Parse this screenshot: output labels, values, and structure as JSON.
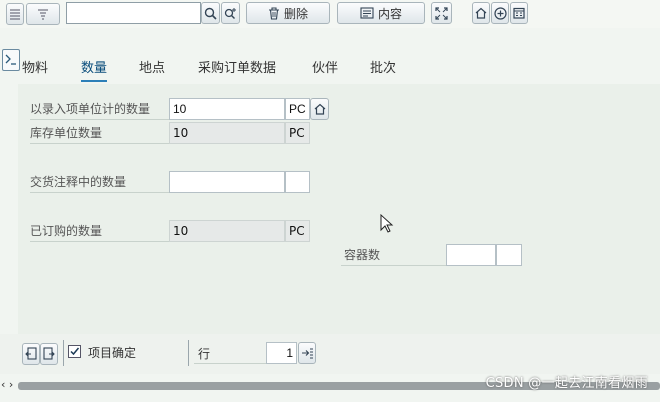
{
  "toolbar": {
    "search_value": "",
    "delete_label": "删除",
    "content_label": "内容"
  },
  "tabs": [
    {
      "label": "物料"
    },
    {
      "label": "数量",
      "active": true
    },
    {
      "label": "地点"
    },
    {
      "label": "采购订单数据"
    },
    {
      "label": "伙伴"
    },
    {
      "label": "批次"
    }
  ],
  "fields": {
    "entry_qty": {
      "label": "以录入项单位计的数量",
      "value": "10",
      "unit": "PC"
    },
    "stock_qty": {
      "label": "库存单位数量",
      "value": "10",
      "unit": "PC"
    },
    "delivery_note_qty": {
      "label": "交货注释中的数量",
      "value": "",
      "unit": ""
    },
    "ordered_qty": {
      "label": "已订购的数量",
      "value": "10",
      "unit": "PC"
    },
    "container_count": {
      "label": "容器数",
      "value": "",
      "unit": ""
    }
  },
  "bottom": {
    "item_ok_label": "项目确定",
    "item_ok_checked": true,
    "row_label": "行",
    "row_value": "1"
  },
  "scroll_arrows": "‹ ›",
  "watermark": "CSDN @一起去江南看烟雨"
}
